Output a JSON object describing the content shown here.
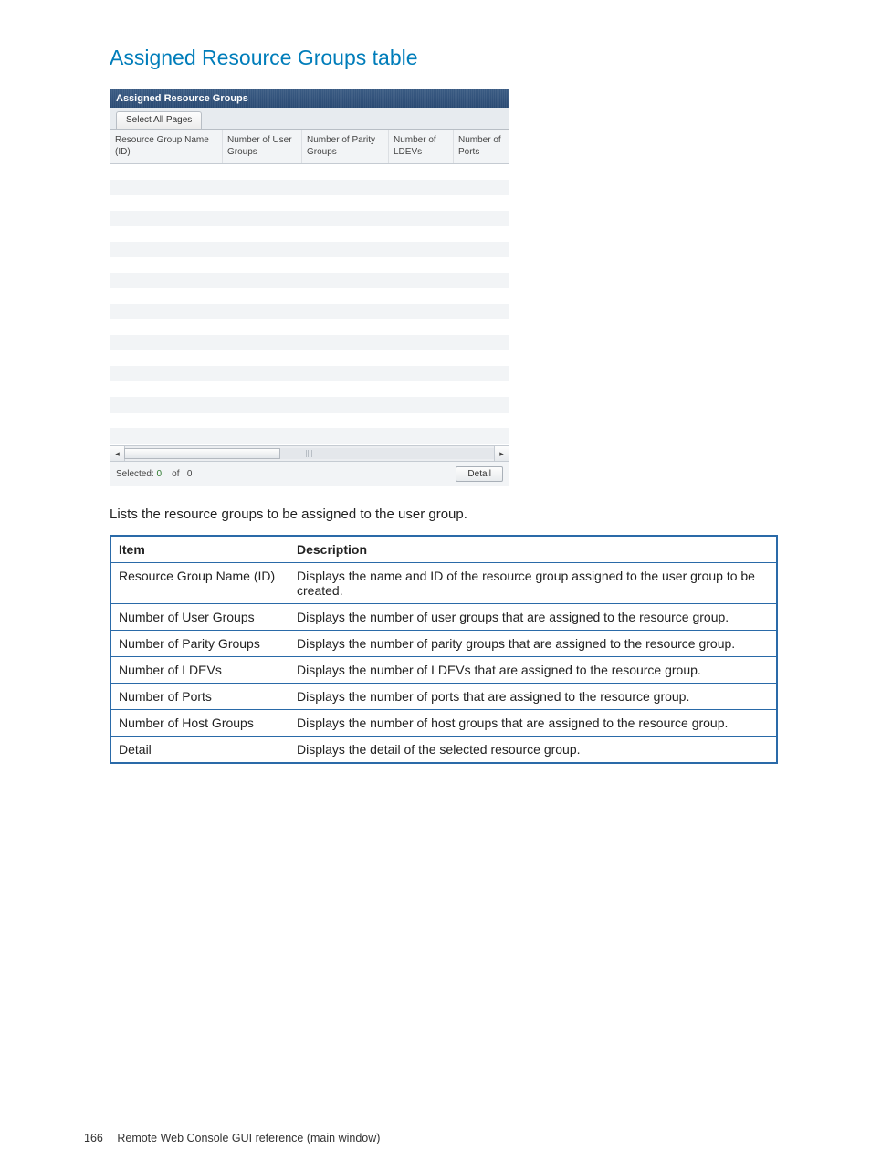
{
  "section_title": "Assigned Resource Groups table",
  "panel": {
    "title": "Assigned Resource Groups",
    "select_all_label": "Select All Pages",
    "columns": {
      "c1": "Resource Group Name (ID)",
      "c2": "Number of User Groups",
      "c3": "Number of Parity Groups",
      "c4": "Number of LDEVs",
      "c5": "Number of Ports"
    },
    "footer": {
      "selected_label": "Selected:",
      "selected_count": "0",
      "of_label": "of",
      "total_count": "0",
      "detail_label": "Detail"
    }
  },
  "description_text": "Lists the resource groups to be assigned to the user group.",
  "def_table": {
    "header_item": "Item",
    "header_desc": "Description",
    "rows": [
      {
        "item": "Resource Group Name (ID)",
        "desc": "Displays the name and ID of the resource group assigned to the user group to be created."
      },
      {
        "item": "Number of User Groups",
        "desc": "Displays the number of user groups that are assigned to the resource group."
      },
      {
        "item": "Number of Parity Groups",
        "desc": "Displays the number of parity groups that are assigned to the resource group."
      },
      {
        "item": "Number of LDEVs",
        "desc": "Displays the number of LDEVs that are assigned to the resource group."
      },
      {
        "item": "Number of Ports",
        "desc": "Displays the number of ports that are assigned to the resource group."
      },
      {
        "item": "Number of Host Groups",
        "desc": "Displays the number of host groups that are assigned to the resource group."
      },
      {
        "item": "Detail",
        "desc": "Displays the detail of the selected resource group."
      }
    ]
  },
  "footer": {
    "page_number": "166",
    "footer_text": "Remote Web Console GUI reference (main window)"
  }
}
